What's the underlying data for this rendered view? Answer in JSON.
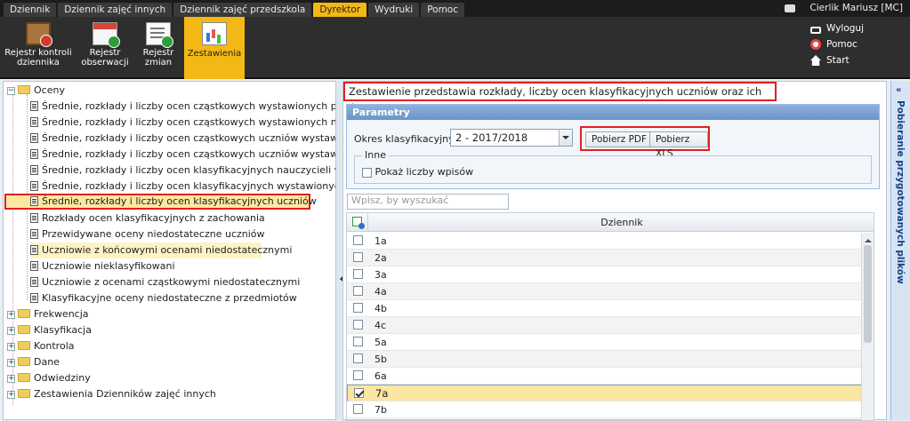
{
  "menu": {
    "tabs": [
      {
        "label": "Dziennik"
      },
      {
        "label": "Dziennik zajęć innych"
      },
      {
        "label": "Dziennik zajęć przedszkola"
      },
      {
        "label": "Dyrektor",
        "active": true
      },
      {
        "label": "Wydruki"
      },
      {
        "label": "Pomoc"
      }
    ],
    "user": "Cierlik Mariusz [MC]"
  },
  "ribbon": {
    "buttons": [
      {
        "label_line1": "Rejestr kontroli",
        "label_line2": "dziennika"
      },
      {
        "label_line1": "Rejestr",
        "label_line2": "obserwacji"
      },
      {
        "label_line1": "Rejestr",
        "label_line2": "zmian"
      },
      {
        "label_line1": "Zestawienia",
        "label_line2": "",
        "active": true
      }
    ],
    "links": {
      "logout": "Wyloguj",
      "help": "Pomoc",
      "start": "Start"
    }
  },
  "tree": {
    "root": "Oceny",
    "children": [
      "Średnie, rozkłady i liczby ocen cząstkowych wystawionych przez nauczycieli",
      "Średnie, rozkłady i liczby ocen cząstkowych wystawionych na przedmiotach",
      "Średnie, rozkłady i liczby ocen cząstkowych uczniów wystawionych przez nauczycieli",
      "Średnie, rozkłady i liczby ocen cząstkowych uczniów wystawionych na przedmiotach",
      "Średnie, rozkłady i liczby ocen klasyfikacyjnych nauczycieli w oddziałach",
      "Średnie, rozkłady i liczby ocen klasyfikacyjnych wystawionych na przedmiotach",
      "Średnie, rozkłady i liczby ocen klasyfikacyjnych uczniów",
      "Rozkłady ocen klasyfikacyjnych z zachowania",
      "Przewidywane oceny niedostateczne uczniów",
      "Uczniowie z końcowymi ocenami niedostatecznymi",
      "Uczniowie nieklasyfikowani",
      "Uczniowie z ocenami cząstkowymi niedostatecznymi",
      "Klasyfikacyjne oceny niedostateczne z przedmiotów"
    ],
    "folders": [
      "Frekwencja",
      "Klasyfikacja",
      "Kontrola",
      "Dane",
      "Odwiedziny",
      "Zestawienia Dzienników zajęć innych"
    ]
  },
  "main": {
    "description": "Zestawienie przedstawia rozkłady, liczby ocen klasyfikacyjnych uczniów oraz ich średnie ocen.",
    "params": {
      "title": "Parametry",
      "okres_label": "Okres klasyfikacyjny:",
      "okres_value": "2 - 2017/2018",
      "pdf_button": "Pobierz PDF",
      "xls_button": "Pobierz XLS",
      "inne_legend": "Inne",
      "pokaz_label": "Pokaż liczby wpisów"
    },
    "search_placeholder": "Wpisz, by wyszukać",
    "grid": {
      "header": "Dziennik",
      "rows": [
        {
          "name": "1a",
          "checked": false
        },
        {
          "name": "2a",
          "checked": false
        },
        {
          "name": "3a",
          "checked": false
        },
        {
          "name": "4a",
          "checked": false
        },
        {
          "name": "4b",
          "checked": false
        },
        {
          "name": "4c",
          "checked": false
        },
        {
          "name": "5a",
          "checked": false
        },
        {
          "name": "5b",
          "checked": false
        },
        {
          "name": "6a",
          "checked": false
        },
        {
          "name": "7a",
          "checked": true
        },
        {
          "name": "7b",
          "checked": false
        }
      ]
    }
  },
  "sidepanel": {
    "title": "Pobieranie przygotowanych plików"
  }
}
